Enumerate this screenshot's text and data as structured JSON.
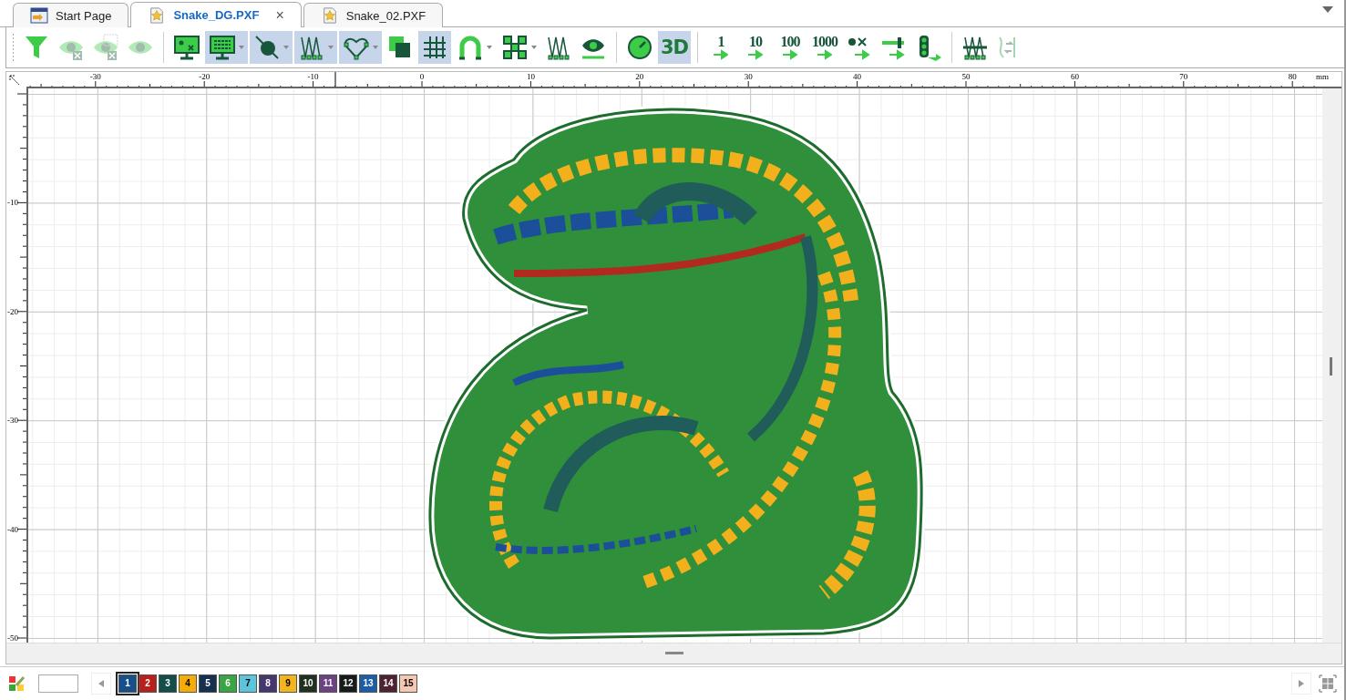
{
  "tabs": [
    {
      "label": "Start Page",
      "kind": "start",
      "selected": false,
      "closable": false
    },
    {
      "label": "Snake_DG.PXF",
      "kind": "file",
      "selected": true,
      "closable": true
    },
    {
      "label": "Snake_02.PXF",
      "kind": "file",
      "selected": false,
      "closable": false
    }
  ],
  "tab_close": "×",
  "toolbar": [
    [
      {
        "kind": "funnel",
        "selected": false,
        "disabled": false,
        "menu": false
      },
      {
        "kind": "eye-x",
        "selected": false,
        "disabled": true,
        "menu": false
      },
      {
        "kind": "eye-frame",
        "selected": false,
        "disabled": true,
        "menu": false
      },
      {
        "kind": "eye",
        "selected": false,
        "disabled": true,
        "menu": false
      }
    ],
    [
      {
        "kind": "monitor-dot",
        "selected": false,
        "disabled": false,
        "menu": false
      },
      {
        "kind": "monitor-grid",
        "selected": true,
        "disabled": false,
        "menu": true
      },
      {
        "kind": "circle-line",
        "selected": true,
        "disabled": false,
        "menu": true
      },
      {
        "kind": "stitches",
        "selected": true,
        "disabled": false,
        "menu": true
      },
      {
        "kind": "heart",
        "selected": true,
        "disabled": false,
        "menu": true
      },
      {
        "kind": "squares",
        "selected": false,
        "disabled": false,
        "menu": false
      },
      {
        "kind": "grid",
        "selected": true,
        "disabled": false,
        "menu": false
      },
      {
        "kind": "magnet",
        "selected": false,
        "disabled": false,
        "menu": true
      },
      {
        "kind": "nodes",
        "selected": false,
        "disabled": false,
        "menu": true
      },
      {
        "kind": "stitches",
        "selected": false,
        "disabled": false,
        "menu": false
      },
      {
        "kind": "eye-slider",
        "selected": false,
        "disabled": false,
        "menu": false
      }
    ],
    [
      {
        "kind": "gauge",
        "selected": false,
        "disabled": false,
        "menu": false
      },
      {
        "kind": "label",
        "label": "3D",
        "selected": true,
        "disabled": false,
        "menu": false
      }
    ],
    [
      {
        "kind": "count",
        "label": "1",
        "selected": false,
        "disabled": false,
        "menu": false
      },
      {
        "kind": "count",
        "label": "10",
        "selected": false,
        "disabled": false,
        "menu": false
      },
      {
        "kind": "count",
        "label": "100",
        "selected": false,
        "disabled": false,
        "menu": false
      },
      {
        "kind": "count",
        "label": "1000",
        "selected": false,
        "disabled": false,
        "menu": false
      },
      {
        "kind": "dot-x",
        "selected": false,
        "disabled": false,
        "menu": false
      },
      {
        "kind": "bar",
        "selected": false,
        "disabled": false,
        "menu": false
      },
      {
        "kind": "lights",
        "selected": false,
        "disabled": false,
        "menu": false
      }
    ],
    [
      {
        "kind": "stitches-bar",
        "selected": false,
        "disabled": false,
        "menu": false
      },
      {
        "kind": "reorder",
        "selected": false,
        "disabled": true,
        "menu": false
      }
    ]
  ],
  "h_ruler": {
    "labels": [
      "-30",
      "-20",
      "-10",
      "0",
      "10",
      "20",
      "30",
      "40",
      "50",
      "60",
      "70",
      "80"
    ],
    "unit": "mm"
  },
  "v_ruler": {
    "labels": [
      "-10",
      "-20",
      "-30",
      "-40",
      "-50"
    ]
  },
  "palette": [
    {
      "label": "1",
      "color": "#164f8c",
      "selected": true
    },
    {
      "label": "2",
      "color": "#b8201c",
      "selected": false
    },
    {
      "label": "3",
      "color": "#134f4a",
      "selected": false
    },
    {
      "label": "4",
      "color": "#f5ac06",
      "selected": false
    },
    {
      "label": "5",
      "color": "#18304f",
      "selected": false
    },
    {
      "label": "6",
      "color": "#3aa544",
      "selected": false
    },
    {
      "label": "7",
      "color": "#5cc4dc",
      "selected": false
    },
    {
      "label": "8",
      "color": "#46386e",
      "selected": false
    },
    {
      "label": "9",
      "color": "#f3b41c",
      "selected": false
    },
    {
      "label": "10",
      "color": "#22301f",
      "selected": false
    },
    {
      "label": "11",
      "color": "#6c4282",
      "selected": false
    },
    {
      "label": "12",
      "color": "#151c19",
      "selected": false
    },
    {
      "label": "13",
      "color": "#1b5ea5",
      "selected": false
    },
    {
      "label": "14",
      "color": "#4f2230",
      "selected": false
    },
    {
      "label": "15",
      "color": "#f6c7b1",
      "selected": false
    }
  ]
}
